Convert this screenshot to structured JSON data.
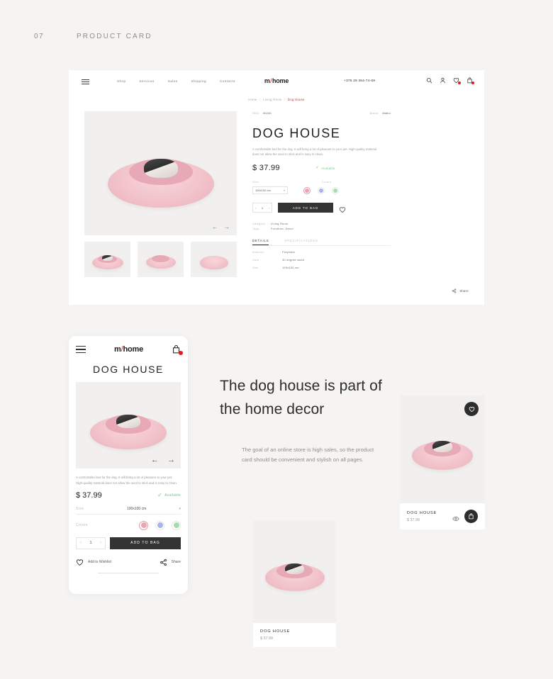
{
  "caption": {
    "number": "07",
    "title": "PRODUCT CARD"
  },
  "brand": {
    "logo_prefix": "m",
    "logo_slash": "/",
    "logo_suffix": "home",
    "accent": "#e31b23"
  },
  "desktop": {
    "nav": [
      "Shop",
      "Services",
      "Sales",
      "Shipping",
      "Contacts"
    ],
    "phone": "+375 29 364-74-69",
    "icons": [
      "search-icon",
      "user-icon",
      "heart-icon",
      "bag-icon"
    ],
    "breadcrumb": {
      "items": [
        "Home",
        "Living Room"
      ],
      "current": "Dog House",
      "separator": "/"
    },
    "gallery": {
      "prev": "←",
      "next": "→",
      "thumb_count": 3
    },
    "product": {
      "sku_label": "SKU:",
      "sku_value": "00240",
      "brand_label": "Brand:",
      "brand_value": "Mahlo",
      "title": "DOG HOUSE",
      "description": "A comfortable bed for the dog. It will bring a lot of pleasure to your pet. High-quality material does not allow the wool to stick and is easy to clean.",
      "price": "$ 37.99",
      "availability": "Available",
      "availability_color": "#7fc48a",
      "size_label": "Size",
      "size_value": "100x100 cm",
      "colors_label": "Colors",
      "colors": [
        "#e9a6b2",
        "#a8b4e8",
        "#a8dcae"
      ],
      "qty_prev": "‹",
      "qty_value": "1",
      "qty_next": "›",
      "add_to_bag": "ADD TO BAG",
      "category_label": "Category:",
      "category_value": "Living Room",
      "tags_label": "Tags:",
      "tags_value": "Furniture, Decor",
      "tabs": [
        {
          "label": "DETAILS",
          "active": true
        },
        {
          "label": "SPECIFICATIONS",
          "active": false
        }
      ],
      "specs": [
        {
          "key": "Material",
          "value": "Polyester"
        },
        {
          "key": "Care",
          "value": "30 degree wash"
        },
        {
          "key": "Size",
          "value": "100x100 cm"
        }
      ],
      "share_label": "Share"
    }
  },
  "mobile": {
    "title": "DOG HOUSE",
    "cart_badge": "1",
    "prev": "←",
    "next": "→",
    "description": "A comfortable bed for the dog. It will bring a lot of pleasure to your pet. High-quality material does not allow the wool to stick and is easy to clean.",
    "price": "$ 37.99",
    "availability": "Available",
    "size_label": "Size",
    "size_value": "100x100 cm",
    "colors_label": "Colors",
    "colors": [
      "#e9a6b2",
      "#a8b4e8",
      "#a8dcae"
    ],
    "qty_prev": "‹",
    "qty_value": "1",
    "qty_next": "›",
    "add_to_bag": "ADD TO BAG",
    "wishlist_label": "Add to Wishlist",
    "share_label": "Share"
  },
  "headline": "The dog house is part of the home decor",
  "paragraph": "The goal of an online store is high sales, so the product card should be convenient and stylish on all pages.",
  "cards": [
    {
      "name": "DOG HOUSE",
      "price": "$ 37.99",
      "has_favorite": true
    },
    {
      "name": "DOG HOUSE",
      "price": "$ 37.99",
      "has_favorite": false
    }
  ]
}
